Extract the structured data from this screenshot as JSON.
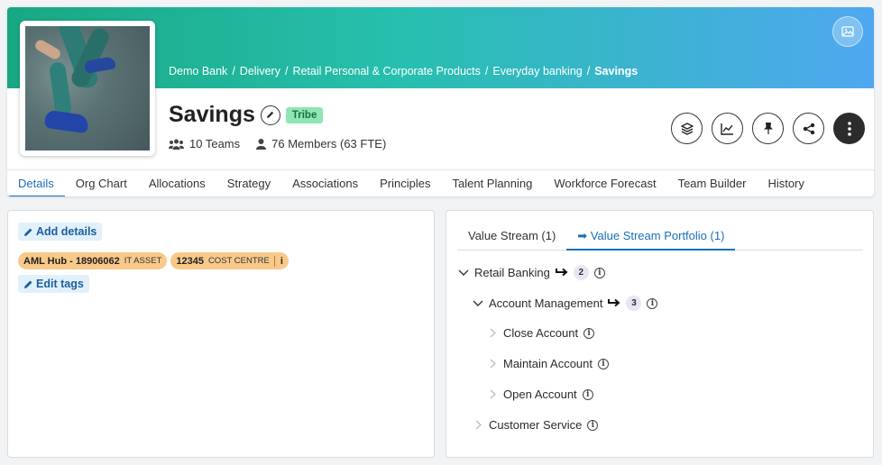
{
  "header": {
    "breadcrumb": [
      "Demo Bank",
      "Delivery",
      "Retail Personal & Corporate Products",
      "Everyday banking"
    ],
    "breadcrumb_current": "Savings",
    "title": "Savings",
    "badge": "Tribe",
    "teams": "10 Teams",
    "members": "76 Members (63 FTE)"
  },
  "tabs": [
    "Details",
    "Org Chart",
    "Allocations",
    "Strategy",
    "Associations",
    "Principles",
    "Talent Planning",
    "Workforce Forecast",
    "Team Builder",
    "History"
  ],
  "details": {
    "add_details": "Add details",
    "edit_tags": "Edit tags",
    "tags": [
      {
        "value": "AML Hub - 18906062",
        "kind": "IT ASSET"
      },
      {
        "value": "12345",
        "kind": "COST CENTRE",
        "info": "i"
      }
    ]
  },
  "value_tabs": [
    "Value Stream (1)",
    "➡ Value Stream Portfolio (1)"
  ],
  "tree": [
    {
      "label": "Retail Banking",
      "count": "2"
    },
    {
      "label": "Account Management",
      "count": "3"
    },
    {
      "label": "Close Account"
    },
    {
      "label": "Maintain Account"
    },
    {
      "label": "Open Account"
    },
    {
      "label": "Customer Service"
    }
  ],
  "colors": {
    "accent": "#1b6fb8",
    "banner_start": "#18a882",
    "banner_end": "#4fa8f0",
    "tribe": "#8ee6b2",
    "tag": "#f9c98a"
  },
  "icons": [
    "image-icon",
    "pencil-icon",
    "teams-icon",
    "person-icon",
    "layers-icon",
    "chart-icon",
    "pin-icon",
    "share-icon",
    "more-icon",
    "chevron-down-icon",
    "chevron-right-icon",
    "info-icon",
    "arrow-icon"
  ]
}
